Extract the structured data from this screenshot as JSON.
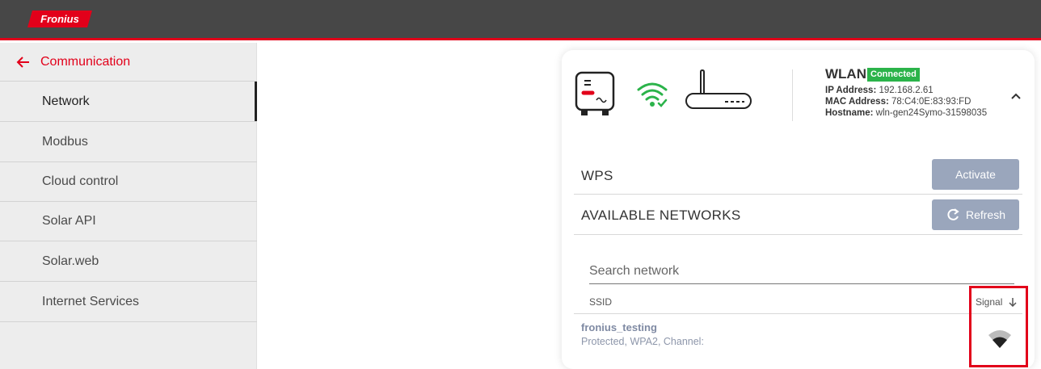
{
  "header": {
    "logo_text": "Fronius"
  },
  "sidebar": {
    "back_label": "Communication",
    "items": [
      {
        "label": "Network"
      },
      {
        "label": "Modbus"
      },
      {
        "label": "Cloud control"
      },
      {
        "label": "Solar API"
      },
      {
        "label": "Solar.web"
      },
      {
        "label": "Internet Services"
      }
    ]
  },
  "wlan": {
    "title": "WLAN",
    "status": "Connected",
    "ip_label": "IP Address:",
    "ip": "192.168.2.61",
    "mac_label": "MAC Address:",
    "mac": "78:C4:0E:83:93:FD",
    "host_label": "Hostname:",
    "host": "wln-gen24Symo-31598035"
  },
  "wps": {
    "label": "WPS",
    "button": "Activate"
  },
  "networks": {
    "label": "AVAILABLE NETWORKS",
    "refresh": "Refresh",
    "search_placeholder": "Search network",
    "col_ssid": "SSID",
    "col_signal": "Signal",
    "list": [
      {
        "ssid": "fronius_testing",
        "details": "Protected, WPA2, Channel:"
      }
    ]
  },
  "colors": {
    "brand": "#e2001a",
    "connected": "#2bb34a",
    "button": "#9aa6bc"
  }
}
